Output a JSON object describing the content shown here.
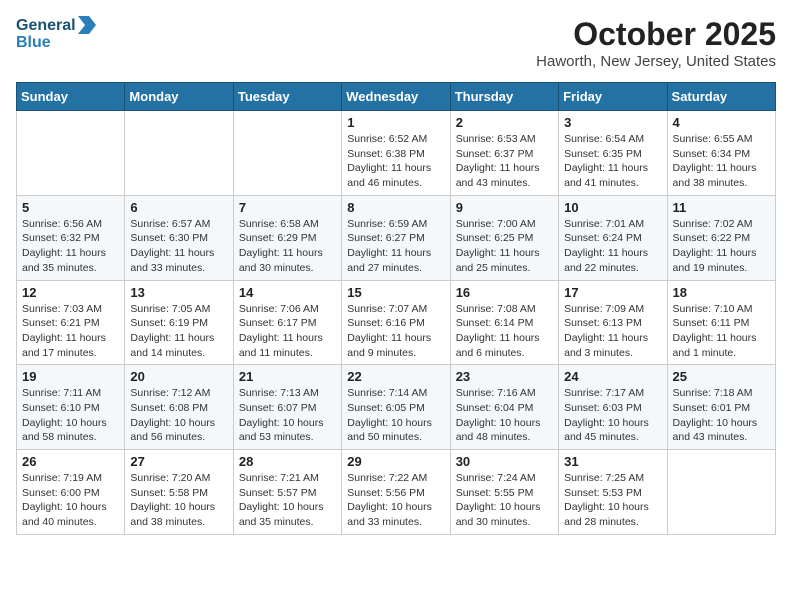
{
  "header": {
    "logo_line1": "General",
    "logo_line2": "Blue",
    "title": "October 2025",
    "subtitle": "Haworth, New Jersey, United States"
  },
  "days_of_week": [
    "Sunday",
    "Monday",
    "Tuesday",
    "Wednesday",
    "Thursday",
    "Friday",
    "Saturday"
  ],
  "weeks": [
    [
      {
        "day": "",
        "detail": ""
      },
      {
        "day": "",
        "detail": ""
      },
      {
        "day": "",
        "detail": ""
      },
      {
        "day": "1",
        "detail": "Sunrise: 6:52 AM\nSunset: 6:38 PM\nDaylight: 11 hours\nand 46 minutes."
      },
      {
        "day": "2",
        "detail": "Sunrise: 6:53 AM\nSunset: 6:37 PM\nDaylight: 11 hours\nand 43 minutes."
      },
      {
        "day": "3",
        "detail": "Sunrise: 6:54 AM\nSunset: 6:35 PM\nDaylight: 11 hours\nand 41 minutes."
      },
      {
        "day": "4",
        "detail": "Sunrise: 6:55 AM\nSunset: 6:34 PM\nDaylight: 11 hours\nand 38 minutes."
      }
    ],
    [
      {
        "day": "5",
        "detail": "Sunrise: 6:56 AM\nSunset: 6:32 PM\nDaylight: 11 hours\nand 35 minutes."
      },
      {
        "day": "6",
        "detail": "Sunrise: 6:57 AM\nSunset: 6:30 PM\nDaylight: 11 hours\nand 33 minutes."
      },
      {
        "day": "7",
        "detail": "Sunrise: 6:58 AM\nSunset: 6:29 PM\nDaylight: 11 hours\nand 30 minutes."
      },
      {
        "day": "8",
        "detail": "Sunrise: 6:59 AM\nSunset: 6:27 PM\nDaylight: 11 hours\nand 27 minutes."
      },
      {
        "day": "9",
        "detail": "Sunrise: 7:00 AM\nSunset: 6:25 PM\nDaylight: 11 hours\nand 25 minutes."
      },
      {
        "day": "10",
        "detail": "Sunrise: 7:01 AM\nSunset: 6:24 PM\nDaylight: 11 hours\nand 22 minutes."
      },
      {
        "day": "11",
        "detail": "Sunrise: 7:02 AM\nSunset: 6:22 PM\nDaylight: 11 hours\nand 19 minutes."
      }
    ],
    [
      {
        "day": "12",
        "detail": "Sunrise: 7:03 AM\nSunset: 6:21 PM\nDaylight: 11 hours\nand 17 minutes."
      },
      {
        "day": "13",
        "detail": "Sunrise: 7:05 AM\nSunset: 6:19 PM\nDaylight: 11 hours\nand 14 minutes."
      },
      {
        "day": "14",
        "detail": "Sunrise: 7:06 AM\nSunset: 6:17 PM\nDaylight: 11 hours\nand 11 minutes."
      },
      {
        "day": "15",
        "detail": "Sunrise: 7:07 AM\nSunset: 6:16 PM\nDaylight: 11 hours\nand 9 minutes."
      },
      {
        "day": "16",
        "detail": "Sunrise: 7:08 AM\nSunset: 6:14 PM\nDaylight: 11 hours\nand 6 minutes."
      },
      {
        "day": "17",
        "detail": "Sunrise: 7:09 AM\nSunset: 6:13 PM\nDaylight: 11 hours\nand 3 minutes."
      },
      {
        "day": "18",
        "detail": "Sunrise: 7:10 AM\nSunset: 6:11 PM\nDaylight: 11 hours\nand 1 minute."
      }
    ],
    [
      {
        "day": "19",
        "detail": "Sunrise: 7:11 AM\nSunset: 6:10 PM\nDaylight: 10 hours\nand 58 minutes."
      },
      {
        "day": "20",
        "detail": "Sunrise: 7:12 AM\nSunset: 6:08 PM\nDaylight: 10 hours\nand 56 minutes."
      },
      {
        "day": "21",
        "detail": "Sunrise: 7:13 AM\nSunset: 6:07 PM\nDaylight: 10 hours\nand 53 minutes."
      },
      {
        "day": "22",
        "detail": "Sunrise: 7:14 AM\nSunset: 6:05 PM\nDaylight: 10 hours\nand 50 minutes."
      },
      {
        "day": "23",
        "detail": "Sunrise: 7:16 AM\nSunset: 6:04 PM\nDaylight: 10 hours\nand 48 minutes."
      },
      {
        "day": "24",
        "detail": "Sunrise: 7:17 AM\nSunset: 6:03 PM\nDaylight: 10 hours\nand 45 minutes."
      },
      {
        "day": "25",
        "detail": "Sunrise: 7:18 AM\nSunset: 6:01 PM\nDaylight: 10 hours\nand 43 minutes."
      }
    ],
    [
      {
        "day": "26",
        "detail": "Sunrise: 7:19 AM\nSunset: 6:00 PM\nDaylight: 10 hours\nand 40 minutes."
      },
      {
        "day": "27",
        "detail": "Sunrise: 7:20 AM\nSunset: 5:58 PM\nDaylight: 10 hours\nand 38 minutes."
      },
      {
        "day": "28",
        "detail": "Sunrise: 7:21 AM\nSunset: 5:57 PM\nDaylight: 10 hours\nand 35 minutes."
      },
      {
        "day": "29",
        "detail": "Sunrise: 7:22 AM\nSunset: 5:56 PM\nDaylight: 10 hours\nand 33 minutes."
      },
      {
        "day": "30",
        "detail": "Sunrise: 7:24 AM\nSunset: 5:55 PM\nDaylight: 10 hours\nand 30 minutes."
      },
      {
        "day": "31",
        "detail": "Sunrise: 7:25 AM\nSunset: 5:53 PM\nDaylight: 10 hours\nand 28 minutes."
      },
      {
        "day": "",
        "detail": ""
      }
    ]
  ]
}
